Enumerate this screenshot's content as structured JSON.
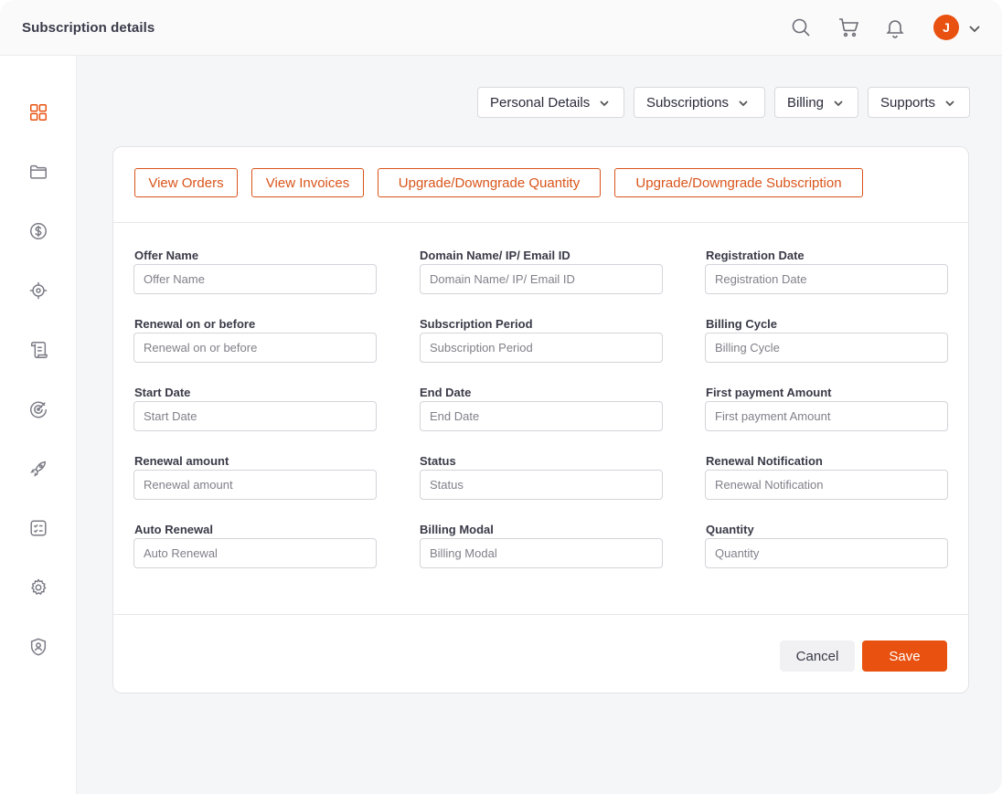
{
  "header": {
    "title": "Subscription details",
    "avatar_initial": "J",
    "accent_color": "#e8510f"
  },
  "icons": {
    "search": "search-icon",
    "cart": "cart-icon",
    "notifications": "bell-icon",
    "account_menu": "chevron-down-icon"
  },
  "sidebar": {
    "items": [
      {
        "icon": "dashboard-grid-icon",
        "active": true
      },
      {
        "icon": "folder-icon",
        "active": false
      },
      {
        "icon": "dollar-icon",
        "active": false
      },
      {
        "icon": "target-icon",
        "active": false
      },
      {
        "icon": "scroll-icon",
        "active": false
      },
      {
        "icon": "radar-icon",
        "active": false
      },
      {
        "icon": "rocket-icon",
        "active": false
      },
      {
        "icon": "checklist-icon",
        "active": false
      },
      {
        "icon": "gear-icon",
        "active": false
      },
      {
        "icon": "shield-user-icon",
        "active": false
      }
    ]
  },
  "nav": {
    "personal_details": "Personal Details",
    "subscriptions": "Subscriptions",
    "billing": "Billing",
    "supports": "Supports"
  },
  "actions": {
    "view_orders": "View Orders",
    "view_invoices": "View Invoices",
    "upgrade_quantity": "Upgrade/Downgrade Quantity",
    "upgrade_subscription": "Upgrade/Downgrade Subscription"
  },
  "form": {
    "offer_name": {
      "label": "Offer Name",
      "placeholder": "Offer Name",
      "value": ""
    },
    "domain_name": {
      "label": "Domain Name/ IP/ Email ID",
      "placeholder": "Domain Name/ IP/ Email ID",
      "value": ""
    },
    "registration_date": {
      "label": "Registration Date",
      "placeholder": "Registration Date",
      "value": ""
    },
    "renewal_on_or_before": {
      "label": "Renewal on or before",
      "placeholder": "Renewal on or before",
      "value": ""
    },
    "subscription_period": {
      "label": "Subscription Period",
      "placeholder": "Subscription Period",
      "value": ""
    },
    "billing_cycle": {
      "label": "Billing Cycle",
      "placeholder": "Billing Cycle",
      "value": ""
    },
    "start_date": {
      "label": "Start Date",
      "placeholder": "Start Date",
      "value": ""
    },
    "end_date": {
      "label": "End Date",
      "placeholder": "End Date",
      "value": ""
    },
    "first_payment_amount": {
      "label": "First payment Amount",
      "placeholder": "First payment Amount",
      "value": ""
    },
    "renewal_amount": {
      "label": "Renewal amount",
      "placeholder": "Renewal amount",
      "value": ""
    },
    "status": {
      "label": "Status",
      "placeholder": "Status",
      "value": ""
    },
    "renewal_notification": {
      "label": "Renewal Notification",
      "placeholder": "Renewal Notification",
      "value": ""
    },
    "auto_renewal": {
      "label": "Auto Renewal",
      "placeholder": "Auto Renewal",
      "value": ""
    },
    "billing_modal": {
      "label": "Billing Modal",
      "placeholder": "Billing Modal",
      "value": ""
    },
    "quantity": {
      "label": "Quantity",
      "placeholder": "Quantity",
      "value": ""
    }
  },
  "footer": {
    "cancel_label": "Cancel",
    "save_label": "Save"
  }
}
